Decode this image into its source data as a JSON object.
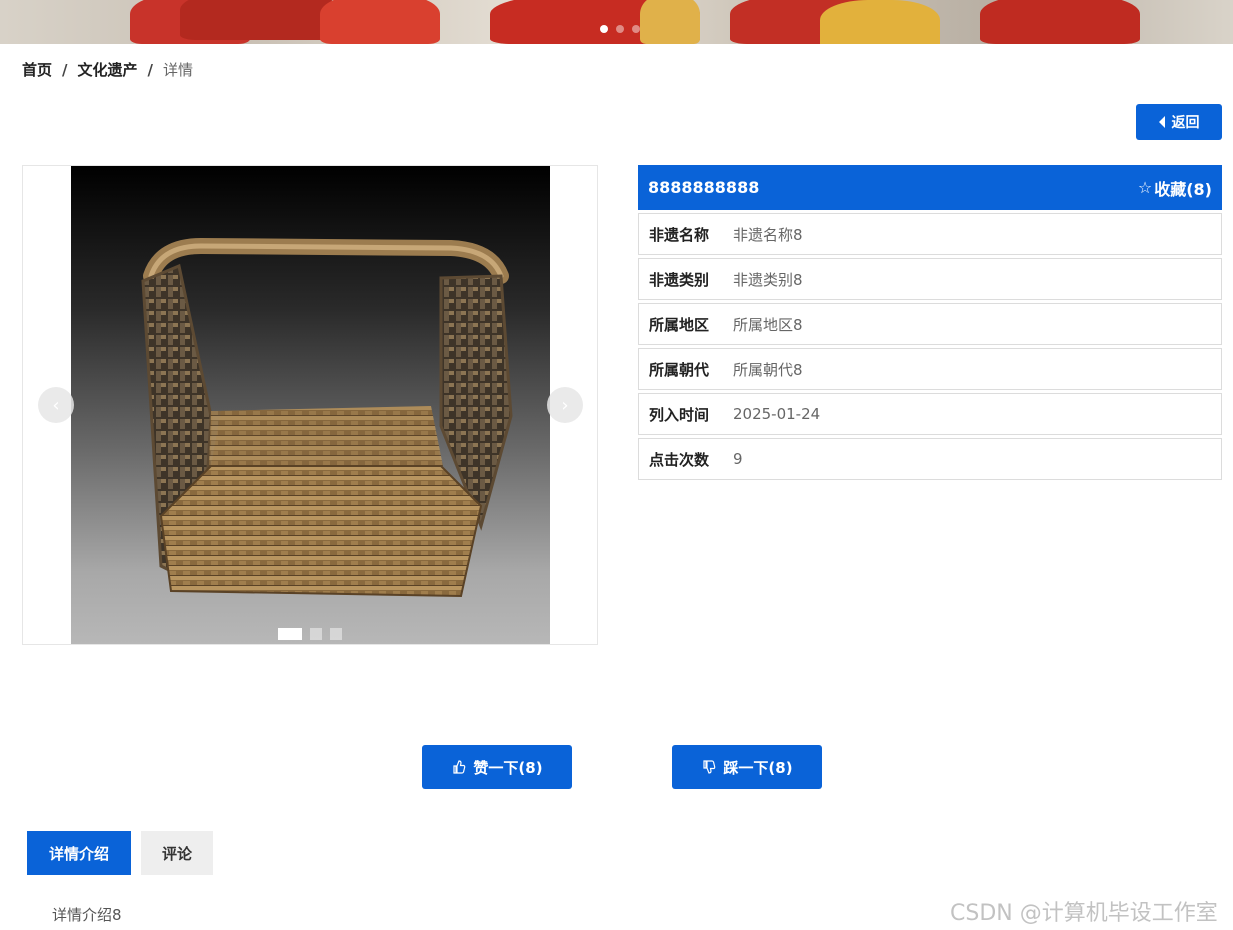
{
  "breadcrumb": {
    "home": "首页",
    "section": "文化遗产",
    "current": "详情",
    "separator": "/"
  },
  "back_button": {
    "label": "返回"
  },
  "carousel": {
    "prev_glyph": "‹",
    "next_glyph": "›",
    "slide_count": 3,
    "active_slide": 1
  },
  "banner": {
    "dot_count": 3,
    "active_dot": 1
  },
  "info": {
    "title": "8888888888",
    "favorite_label": "收藏(8)",
    "rows": [
      {
        "label": "非遗名称",
        "value": "非遗名称8"
      },
      {
        "label": "非遗类别",
        "value": "非遗类别8"
      },
      {
        "label": "所属地区",
        "value": "所属地区8"
      },
      {
        "label": "所属朝代",
        "value": "所属朝代8"
      },
      {
        "label": "列入时间",
        "value": "2025-01-24"
      },
      {
        "label": "点击次数",
        "value": "9"
      }
    ]
  },
  "votes": {
    "like_label": "赞一下(8)",
    "dislike_label": "踩一下(8)"
  },
  "tabs": [
    {
      "label": "详情介绍",
      "active": true
    },
    {
      "label": "评论",
      "active": false
    }
  ],
  "detail": {
    "text": "详情介绍8"
  },
  "watermark": "CSDN @计算机毕设工作室",
  "colors": {
    "accent": "#0a63d8"
  },
  "icons": {
    "back": "caret-left-icon",
    "favorite": "star-outline-icon",
    "like": "thumbs-up-icon",
    "dislike": "thumbs-down-icon"
  }
}
